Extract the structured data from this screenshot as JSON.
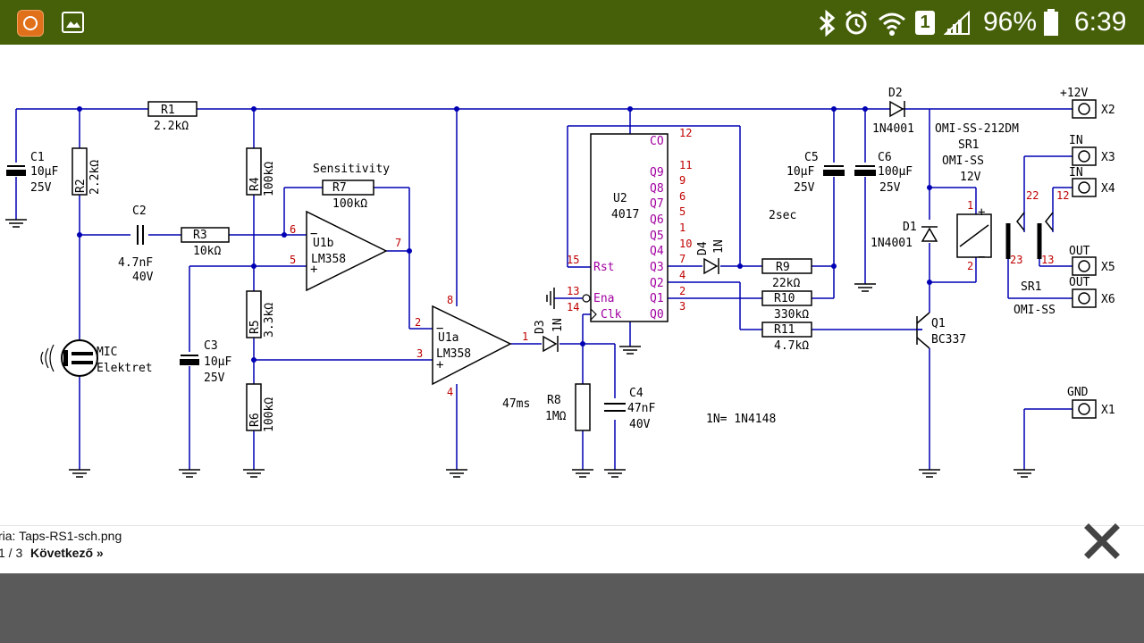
{
  "status_bar": {
    "battery": "96%",
    "time": "6:39",
    "sim_slot": "1",
    "icons": [
      "app-icon",
      "gallery-icon",
      "bluetooth-icon",
      "alarm-icon",
      "wifi-icon",
      "sim-icon",
      "signal-icon",
      "battery-icon"
    ]
  },
  "schematic": {
    "components": {
      "r1": "R1",
      "r1_val": "2.2kΩ",
      "r2": "R2",
      "r2_val": "2.2kΩ",
      "r3": "R3",
      "r3_val": "10kΩ",
      "r4": "R4",
      "r4_val": "100kΩ",
      "r5": "R5",
      "r5_val": "3.3kΩ",
      "r6": "R6",
      "r6_val": "100kΩ",
      "r7": "R7",
      "r7_val": "100kΩ",
      "r8": "R8",
      "r8_val": "1MΩ",
      "r9": "R9",
      "r9_val": "22kΩ",
      "r10": "R10",
      "r10_val": "330kΩ",
      "r11": "R11",
      "r11_val": "4.7kΩ",
      "c1": "C1",
      "c1_val": "10µF",
      "c1_v": "25V",
      "c2": "C2",
      "c2_val": "4.7nF",
      "c2_v": "40V",
      "c3": "C3",
      "c3_val": "10µF",
      "c3_v": "25V",
      "c4": "C4",
      "c4_val": "47nF",
      "c4_v": "40V",
      "c5": "C5",
      "c5_val": "10µF",
      "c5_v": "25V",
      "c6": "C6",
      "c6_val": "100µF",
      "c6_v": "25V",
      "d1": "D1",
      "d1_val": "1N4001",
      "d2": "D2",
      "d2_val": "1N4001",
      "d3": "D3",
      "d3_val": "1N",
      "d4": "D4",
      "d4_val": "1N",
      "u1a": "U1a",
      "u1a_val": "LM358",
      "u1b": "U1b",
      "u1b_val": "LM358",
      "u2": "U2",
      "u2_val": "4017",
      "q1": "Q1",
      "q1_val": "BC337",
      "mic": "MIC",
      "mic_val": "Elektret",
      "sr1_title": "OMI-SS-212DM",
      "sr1": "SR1",
      "sr1_model": "OMI-SS",
      "sr1_v": "12V",
      "sr1_contacts": "SR1",
      "sr1_contacts_model": "OMI-SS"
    },
    "labels": {
      "sensitivity": "Sensitivity",
      "two_sec": "2sec",
      "timing": "47ms",
      "diode_note": "1N= 1N4148",
      "plus12v": "+12V",
      "in1": "IN",
      "in2": "IN",
      "out1": "OUT",
      "out2": "OUT",
      "gnd": "GND"
    },
    "connectors": {
      "x1": "X1",
      "x2": "X2",
      "x3": "X3",
      "x4": "X4",
      "x5": "X5",
      "x6": "X6"
    },
    "u2_pins": {
      "co": "CO",
      "q9": "Q9",
      "q8": "Q8",
      "q7": "Q7",
      "q6": "Q6",
      "q5": "Q5",
      "q4": "Q4",
      "q3": "Q3",
      "q2": "Q2",
      "q1": "Q1",
      "q0": "Q0",
      "rst": "Rst",
      "ena": "Ena",
      "clk": "Clk",
      "n12": "12",
      "n11": "11",
      "n9": "9",
      "n6": "6",
      "n5": "5",
      "n1": "1",
      "n10": "10",
      "n7": "7",
      "n4": "4",
      "n2": "2",
      "n3": "3",
      "n15": "15",
      "n13": "13",
      "n14": "14"
    },
    "opamp_pins": {
      "b6": "6",
      "b5": "5",
      "b7": "7",
      "a8": "8",
      "a2": "2",
      "a3": "3",
      "a1": "1",
      "a4": "4"
    },
    "relay_pins": {
      "p1": "1",
      "p2": "2",
      "p22": "22",
      "p12": "12",
      "p23": "23",
      "p13": "13"
    }
  },
  "caption": {
    "filename": "ria: Taps-RS1-sch.png",
    "page": "1 / 3",
    "next": "Következő »"
  }
}
